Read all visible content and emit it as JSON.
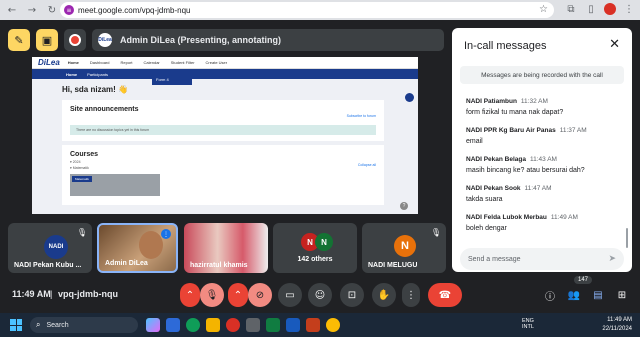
{
  "browser": {
    "url": "meet.google.com/vpq-jdmb-nqu"
  },
  "meet": {
    "presenting_label": "Admin DiLea (Presenting, annotating)",
    "presenter_logo": "DiLea",
    "time": "11:49 AM",
    "separator": "|",
    "meeting_code": "vpq-jdmb-nqu",
    "participant_count": "147"
  },
  "shared_screen": {
    "logo": "DiLea",
    "nav": [
      "Home",
      "Dashboard",
      "Report",
      "Calendar",
      "Student Filter",
      "Create User"
    ],
    "dropdown_item": "Form 4",
    "tabs": [
      "Home",
      "Participants"
    ],
    "greeting": "Hi, sda nizam! 👋",
    "announcements_title": "Site announcements",
    "subscribe_link": "Subscribe to forum",
    "notice": "There are no discussion topics yet in this forum",
    "courses_title": "Courses",
    "collapse_link": "Collapse all",
    "course_year": "▾ 2024",
    "course_sub": "▾ Matematik",
    "course_badge": "Matematik"
  },
  "chat": {
    "title": "In-call messages",
    "recording_notice": "Messages are being recorded with the call",
    "messages": [
      {
        "sender": "NADI Patiambun",
        "time": "11:32 AM",
        "text": "form fizikal tu mana nak dapat?"
      },
      {
        "sender": "NADI PPR Kg Baru Air Panas",
        "time": "11:37 AM",
        "text": "email"
      },
      {
        "sender": "NADI Pekan Belaga",
        "time": "11:43 AM",
        "text": "masih bincang ke? atau bersurai dah?"
      },
      {
        "sender": "NADI Pekan Sook",
        "time": "11:47 AM",
        "text": "takda suara"
      },
      {
        "sender": "NADI Felda Lubok Merbau",
        "time": "11:49 AM",
        "text": "boleh dengar"
      }
    ],
    "input_placeholder": "Send a message"
  },
  "tiles": [
    {
      "name": "NADI Pekan Kubu ...",
      "logo": "NADI"
    },
    {
      "name": "Admin DiLea"
    },
    {
      "name": "hazirratul khamis"
    },
    {
      "name": "142 others",
      "initials": [
        "N",
        "N"
      ]
    },
    {
      "name": "NADI MELUGU",
      "initial": "N"
    }
  ],
  "taskbar": {
    "search": "Search",
    "lang1": "ENG",
    "lang2": "INTL",
    "clock_time": "11:49 AM",
    "clock_date": "22/11/2024"
  },
  "colors": {
    "meet_bg": "#202124",
    "hangup": "#ea4335",
    "presenter_ring": "#8ab4f8",
    "annotate_yellow": "#fdd663",
    "brand_blue": "#1a3b8c"
  }
}
